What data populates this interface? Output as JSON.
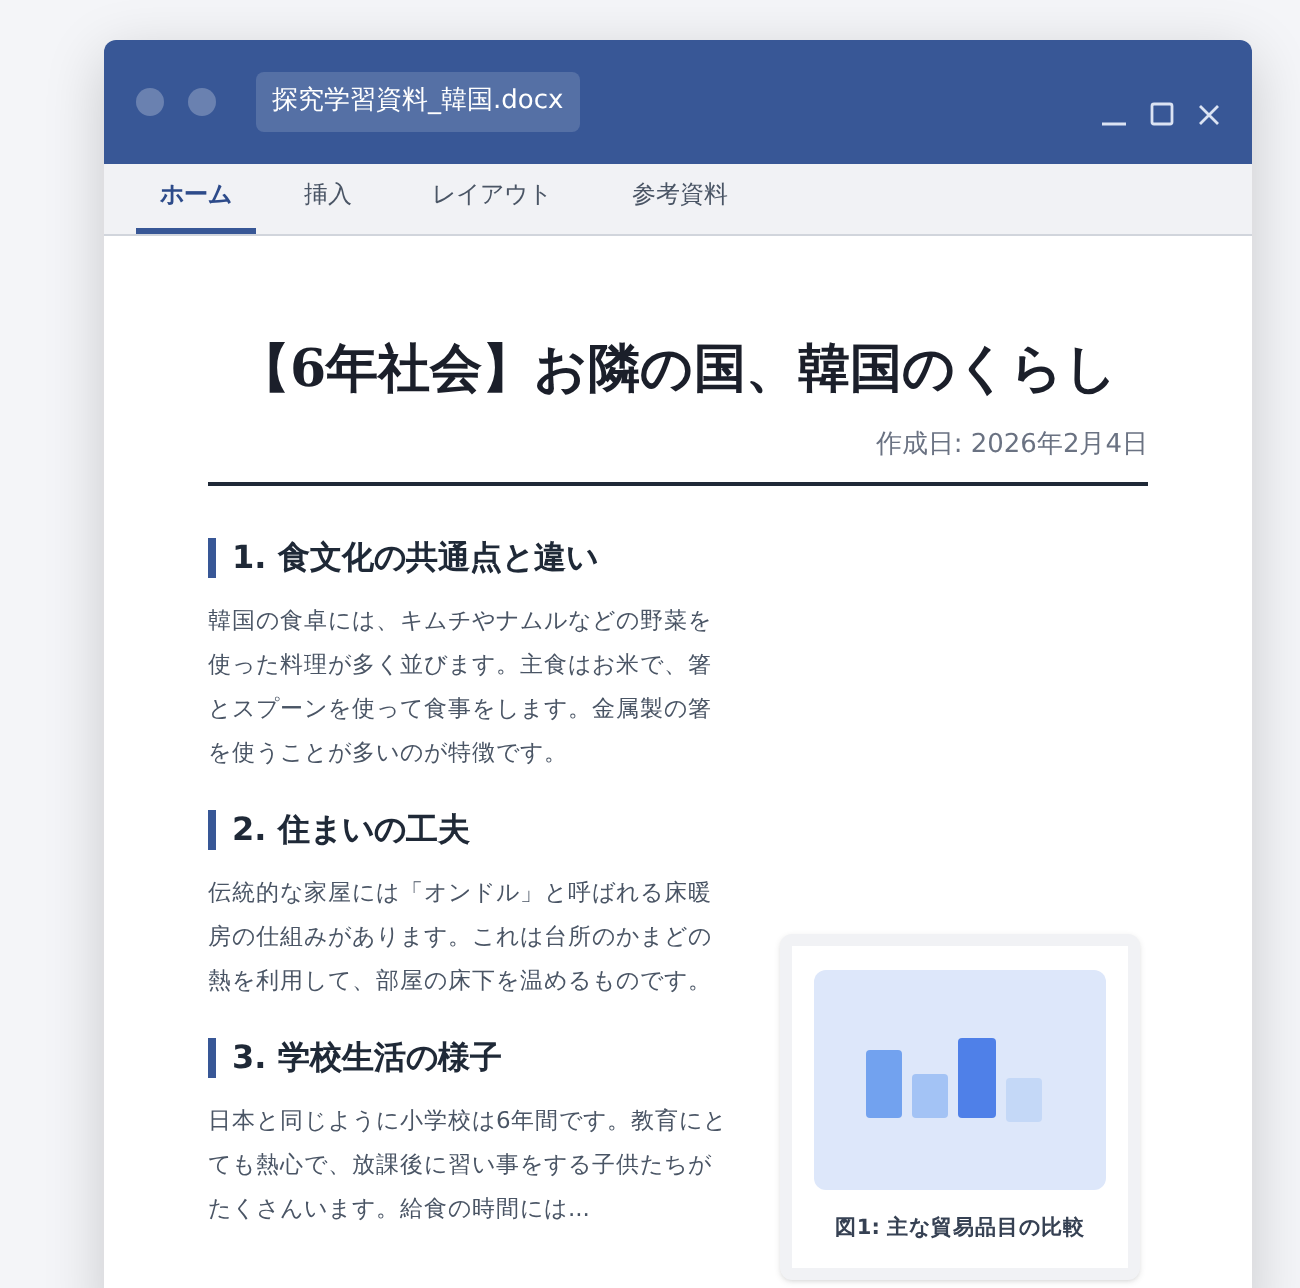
{
  "window": {
    "title": "探究学習資料_韓国.docx"
  },
  "tabs": [
    {
      "label": "ホーム",
      "selected": true
    },
    {
      "label": "挿入",
      "selected": false
    },
    {
      "label": "レイアウト",
      "selected": false
    },
    {
      "label": "参考資料",
      "selected": false
    }
  ],
  "document": {
    "title": "【6年社会】お隣の国、韓国のくらし",
    "date": "作成日: 2026年2月4日",
    "sections": [
      {
        "heading": "1. 食文化の共通点と違い",
        "body": "韓国の食卓には、キムチやナムルなどの野菜を使った料理が多く並びます。主食はお米で、箸とスプーンを使って食事をします。金属製の箸を使うことが多いのが特徴です。"
      },
      {
        "heading": "2. 住まいの工夫",
        "body": "伝統的な家屋には「オンドル」と呼ばれる床暖房の仕組みがあります。これは台所のかまどの熱を利用して、部屋の床下を温めるものです。"
      },
      {
        "heading": "3. 学校生活の様子",
        "body": "日本と同じように小学校は6年間です。教育にとても熱心で、放課後に習い事をする子供たちがたくさんいます。給食の時間には..."
      }
    ],
    "figure": {
      "caption": "図1: 主な貿易品目の比較"
    }
  }
}
